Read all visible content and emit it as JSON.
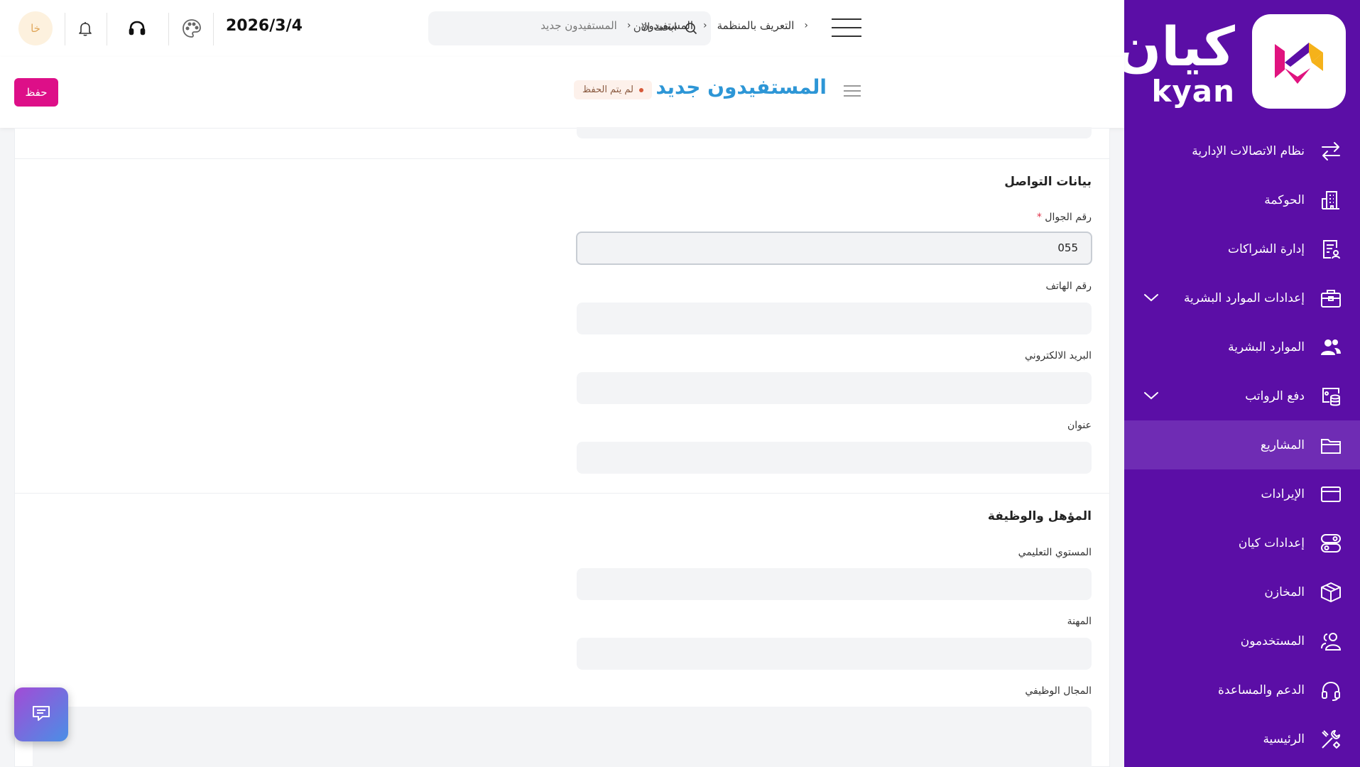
{
  "brand": {
    "name_ar": "كيان",
    "name_en": "kyan",
    "color_primary": "#5b0ea6",
    "color_accent": "#dd0f88"
  },
  "sidebar": {
    "items": [
      {
        "label": "نظام الاتصالات الإدارية",
        "icon": "arrows-exchange-icon",
        "expandable": false
      },
      {
        "label": "الحوكمة",
        "icon": "building-icon",
        "expandable": false
      },
      {
        "label": "إدارة الشراكات",
        "icon": "document-user-icon",
        "expandable": false
      },
      {
        "label": "إعدادات الموارد البشرية",
        "icon": "briefcase-icon",
        "expandable": true
      },
      {
        "label": "الموارد البشرية",
        "icon": "users-icon",
        "expandable": false
      },
      {
        "label": "دفع الرواتب",
        "icon": "payroll-icon",
        "expandable": true
      },
      {
        "label": "المشاريع",
        "icon": "folder-icon",
        "expandable": false,
        "active": true
      },
      {
        "label": "الإيرادات",
        "icon": "card-icon",
        "expandable": false
      },
      {
        "label": "إعدادات كيان",
        "icon": "toggles-icon",
        "expandable": false
      },
      {
        "label": "المخازن",
        "icon": "box-icon",
        "expandable": false
      },
      {
        "label": "المستخدمون",
        "icon": "user-group-icon",
        "expandable": false
      },
      {
        "label": "الدعم والمساعدة",
        "icon": "headset-icon",
        "expandable": false
      },
      {
        "label": "الرئيسية",
        "icon": "tools-icon",
        "expandable": false
      }
    ]
  },
  "topbar": {
    "avatar_initials": "خا",
    "date": "2026/3/4",
    "search_placeholder": "ابحث الان",
    "breadcrumb": [
      "التعريف بالمنظمة",
      "المستفيدون",
      "المستفيدون جديد"
    ]
  },
  "page_header": {
    "title": "المستفيدون جديد",
    "status_badge": "لم يتم الحفظ",
    "save_label": "حفظ"
  },
  "form": {
    "contact_section": {
      "title": "بيانات التواصل",
      "mobile_label": "رقم الجوال",
      "mobile_required_mark": "*",
      "mobile_value": "055",
      "phone_label": "رقم الهاتف",
      "email_label": "البريد الالكتروني",
      "address_label": "عنوان"
    },
    "qualification_section": {
      "title": "المؤهل والوظيفة",
      "education_label": "المستوي التعليمي",
      "profession_label": "المهنة",
      "job_field_label": "المجال الوظيفي"
    }
  }
}
